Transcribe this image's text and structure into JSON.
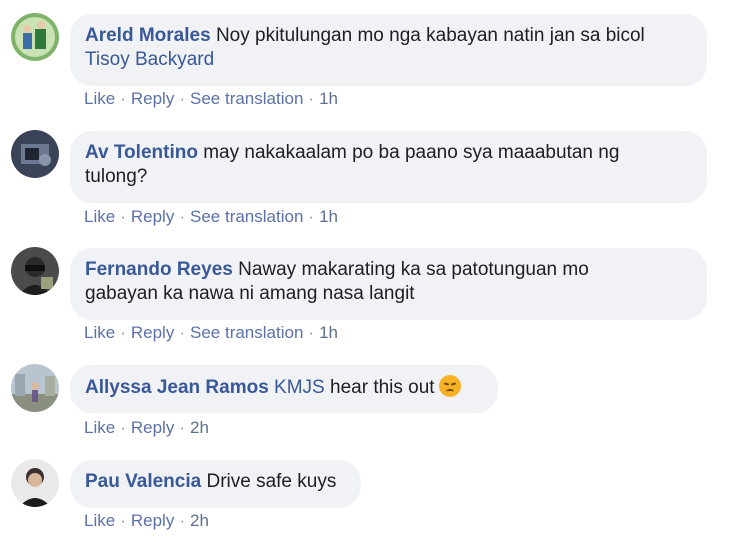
{
  "actions": {
    "like": "Like",
    "reply": "Reply",
    "see_translation": "See translation",
    "dot": "·"
  },
  "comments": [
    {
      "author": "Areld Morales",
      "text_line1": "Noy pkitulungan mo nga kabayan natin jan sa bicol",
      "text_line2": "Tisoy Backyard",
      "time": "1h",
      "avatar": "green-logo-avatar"
    },
    {
      "author": "Av Tolentino",
      "text_line1": "may nakakaalam po ba paano sya maaabutan ng",
      "text_line2": "tulong?",
      "time": "1h",
      "avatar": "dark-photo-avatar"
    },
    {
      "author": "Fernando Reyes",
      "text_line1": "Naway makarating ka sa patotunguan mo",
      "text_line2": "gabayan ka nawa ni amang nasa langit",
      "time": "1h",
      "avatar": "person-photo-avatar"
    },
    {
      "author": "Allyssa Jean Ramos",
      "tag": "KMJS",
      "text_line1": "hear this out",
      "time": "2h",
      "avatar": "outdoor-photo-avatar",
      "emoji": "sad-face-emoji"
    },
    {
      "author": "Pau Valencia",
      "text_line1": "Drive safe kuys",
      "time": "2h",
      "avatar": "portrait-avatar"
    }
  ]
}
